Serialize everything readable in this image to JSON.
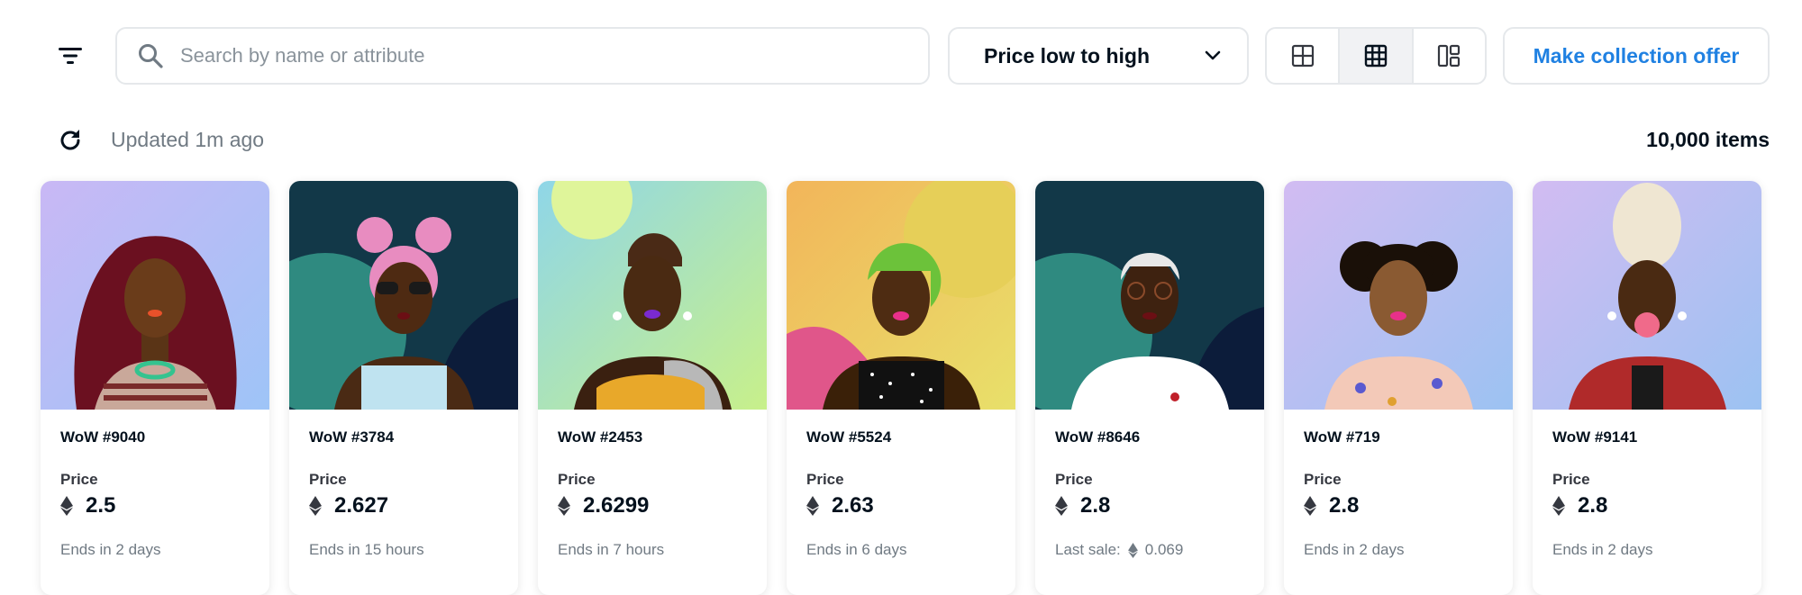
{
  "search": {
    "placeholder": "Search by name or attribute",
    "value": ""
  },
  "sort": {
    "selected": "Price low to high"
  },
  "offer_button": {
    "label": "Make collection offer"
  },
  "status": {
    "updated": "Updated 1m ago",
    "count": "10,000 items"
  },
  "colors": {
    "accent": "#2081e2",
    "border": "#e5e8eb",
    "muted": "#707a83"
  },
  "price_label": "Price",
  "cards": [
    {
      "name": "WoW #9040",
      "price": "2.5",
      "footer": "Ends in 2 days"
    },
    {
      "name": "WoW #3784",
      "price": "2.627",
      "footer": "Ends in 15 hours"
    },
    {
      "name": "WoW #2453",
      "price": "2.6299",
      "footer": "Ends in 7 hours"
    },
    {
      "name": "WoW #5524",
      "price": "2.63",
      "footer": "Ends in 6 days"
    },
    {
      "name": "WoW #8646",
      "price": "2.8",
      "footer": "Last sale:",
      "last_sale": "0.069"
    },
    {
      "name": "WoW #719",
      "price": "2.8",
      "footer": "Ends in 2 days"
    },
    {
      "name": "WoW #9141",
      "price": "2.8",
      "footer": "Ends in 2 days"
    }
  ]
}
